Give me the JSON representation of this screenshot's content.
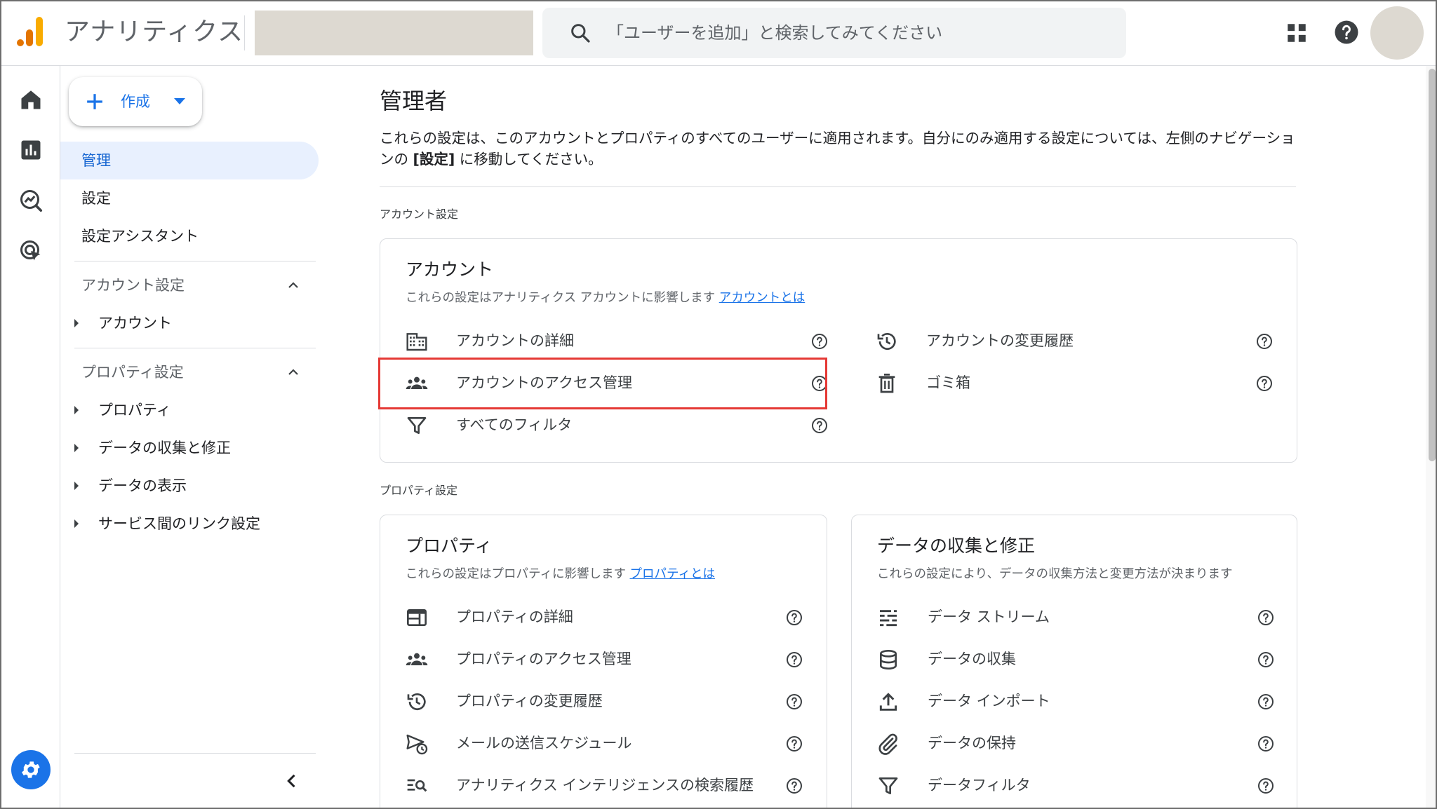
{
  "header": {
    "app_title": "アナリティクス",
    "search_placeholder": "「ユーザーを追加」と検索してみてください"
  },
  "sidebar": {
    "create_label": "作成",
    "items": [
      {
        "label": "管理",
        "active": true
      },
      {
        "label": "設定"
      },
      {
        "label": "設定アシスタント"
      }
    ],
    "sections": [
      {
        "label": "アカウント設定",
        "children": [
          "アカウント"
        ]
      },
      {
        "label": "プロパティ設定",
        "children": [
          "プロパティ",
          "データの収集と修正",
          "データの表示",
          "サービス間のリンク設定"
        ]
      }
    ]
  },
  "main": {
    "title": "管理者",
    "description_part1": "これらの設定は、このアカウントとプロパティのすべてのユーザーに適用されます。自分にのみ適用する設定については、左側のナビゲーションの ",
    "description_bold": "[設定]",
    "description_part2": " に移動してください。",
    "account_section_label": "アカウント設定",
    "property_section_label": "プロパティ設定",
    "account_card": {
      "title": "アカウント",
      "subtitle": "これらの設定はアナリティクス アカウントに影響します",
      "link": "アカウントとは",
      "left_rows": [
        "アカウントの詳細",
        "アカウントのアクセス管理",
        "すべてのフィルタ"
      ],
      "right_rows": [
        "アカウントの変更履歴",
        "ゴミ箱"
      ]
    },
    "property_card": {
      "title": "プロパティ",
      "subtitle": "これらの設定はプロパティに影響します",
      "link": "プロパティとは",
      "rows": [
        "プロパティの詳細",
        "プロパティのアクセス管理",
        "プロパティの変更履歴",
        "メールの送信スケジュール",
        "アナリティクス インテリジェンスの検索履歴"
      ]
    },
    "data_card": {
      "title": "データの収集と修正",
      "subtitle": "これらの設定により、データの収集方法と変更方法が決まります",
      "rows": [
        "データ ストリーム",
        "データの収集",
        "データ インポート",
        "データの保持",
        "データフィルタ"
      ]
    }
  },
  "colors": {
    "accent": "#1a73e8",
    "active_nav_bg": "#e8f0fe",
    "highlight_box": "#e53935",
    "logo_orange": "#f9ab00",
    "logo_dark_orange": "#e37400"
  }
}
